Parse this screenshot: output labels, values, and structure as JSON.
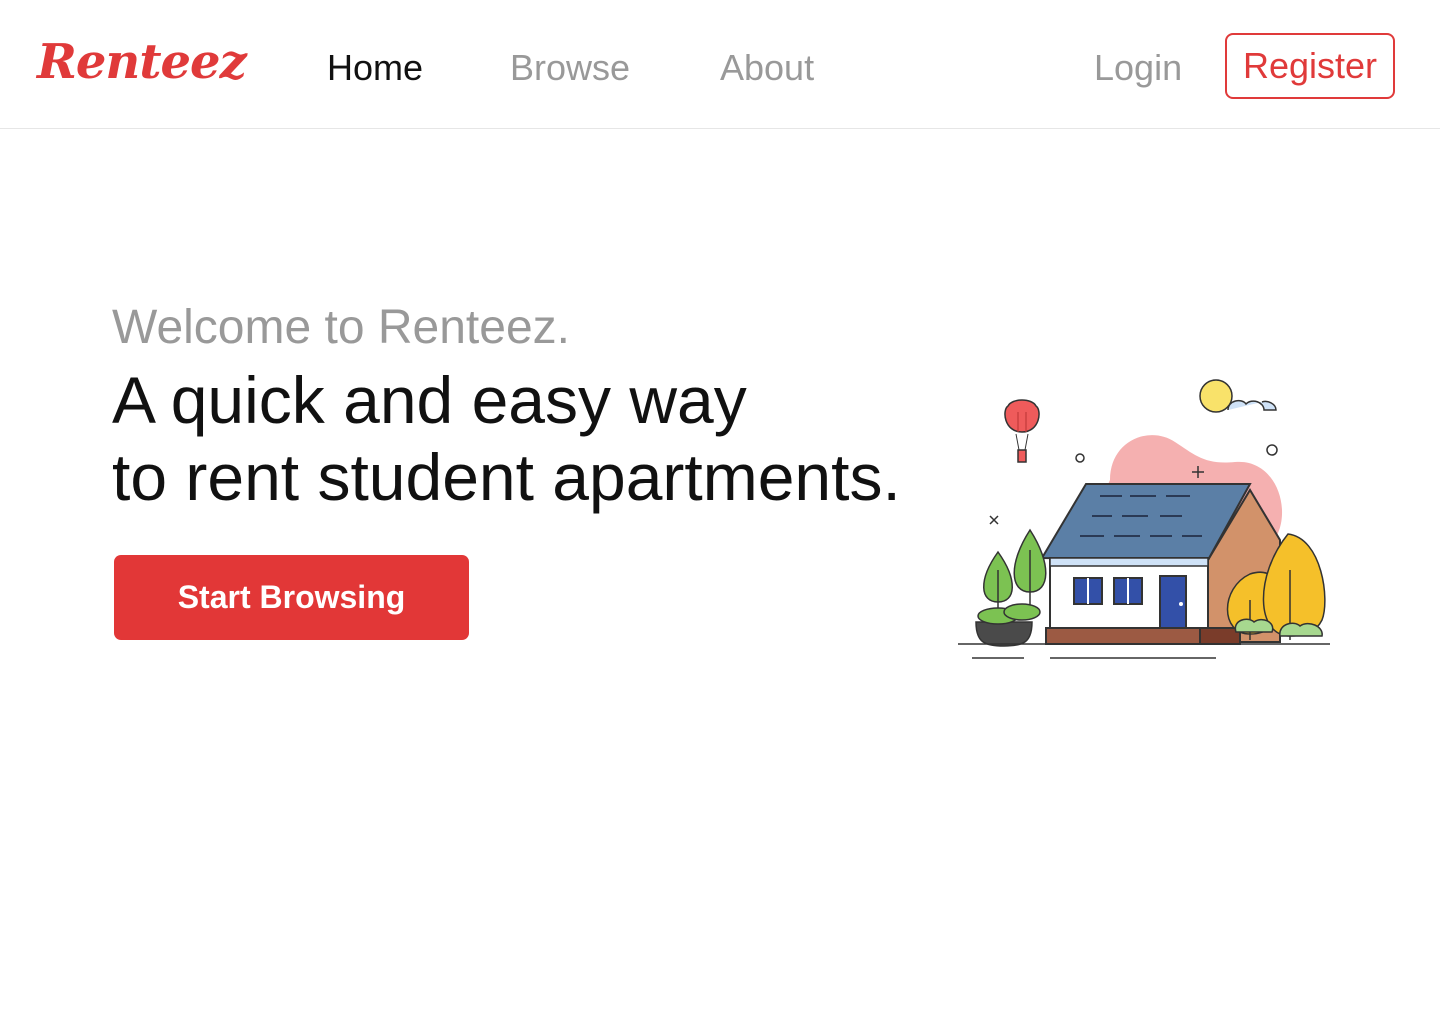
{
  "brand": {
    "logo_text": "Renteez",
    "accent_color": "#e03a3a"
  },
  "nav": {
    "links": [
      {
        "label": "Home",
        "active": true
      },
      {
        "label": "Browse",
        "active": false
      },
      {
        "label": "About",
        "active": false
      }
    ],
    "login_label": "Login",
    "register_label": "Register"
  },
  "hero": {
    "welcome": "Welcome to Renteez.",
    "headline_line1": "A quick and easy way",
    "headline_line2": "to rent student apartments.",
    "cta_label": "Start Browsing",
    "cta_color": "#e23737"
  },
  "illustration": {
    "icon": "house-illustration",
    "palette": {
      "roof": "#5b7fa6",
      "wall": "#ffffff",
      "side_wall": "#d2926a",
      "window": "#3350a8",
      "blob": "#f5a8a8",
      "sun": "#f9e26a",
      "tree_green": "#7cc252",
      "tree_yellow": "#f5c02a",
      "balloon": "#ef5b5b"
    }
  }
}
